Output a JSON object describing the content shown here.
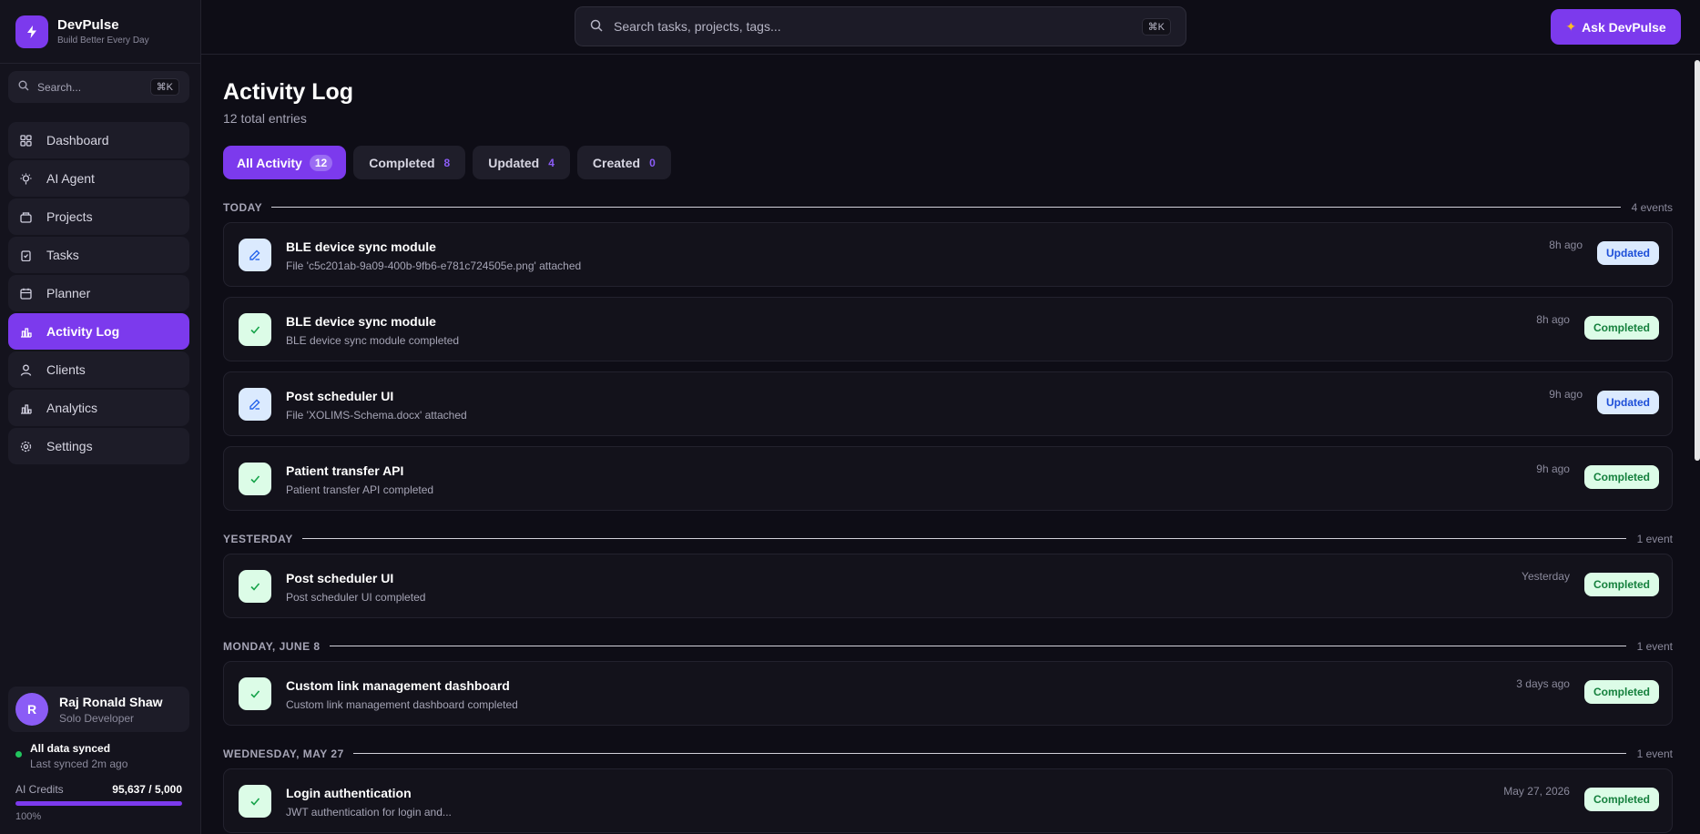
{
  "brand": {
    "name": "DevPulse",
    "tagline": "Build Better Every Day"
  },
  "sidebar": {
    "search_placeholder": "Search...",
    "search_shortcut": "⌘K",
    "items": [
      {
        "label": "Dashboard",
        "icon": "grid-icon"
      },
      {
        "label": "AI Agent",
        "icon": "bulb-icon"
      },
      {
        "label": "Projects",
        "icon": "folder-icon"
      },
      {
        "label": "Tasks",
        "icon": "clipboard-icon"
      },
      {
        "label": "Planner",
        "icon": "calendar-icon"
      },
      {
        "label": "Activity Log",
        "icon": "bar-chart-icon",
        "active": true
      },
      {
        "label": "Clients",
        "icon": "user-icon"
      },
      {
        "label": "Analytics",
        "icon": "bar-chart-icon"
      },
      {
        "label": "Settings",
        "icon": "gear-icon"
      }
    ]
  },
  "user": {
    "initial": "R",
    "name": "Raj Ronald Shaw",
    "role": "Solo Developer"
  },
  "sync": {
    "title": "All data synced",
    "subtitle": "Last synced 2m ago"
  },
  "credits": {
    "label": "AI Credits",
    "value": "95,637 / 5,000",
    "percent_text": "100%",
    "fill_fraction": 1.0
  },
  "topbar": {
    "search_placeholder": "Search tasks, projects, tags...",
    "search_shortcut": "⌘K",
    "ask_label": "Ask DevPulse"
  },
  "page": {
    "title": "Activity Log",
    "subtitle": "12 total entries"
  },
  "filters": [
    {
      "label": "All Activity",
      "count": "12",
      "active": true
    },
    {
      "label": "Completed",
      "count": "8"
    },
    {
      "label": "Updated",
      "count": "4"
    },
    {
      "label": "Created",
      "count": "0"
    }
  ],
  "groups": [
    {
      "label": "TODAY",
      "count": "4 events",
      "entries": [
        {
          "title": "BLE device sync module",
          "desc": "File 'c5c201ab-9a09-400b-9fb6-e781c724505e.png' attached",
          "time": "8h ago",
          "status": "Updated",
          "kind": "updated"
        },
        {
          "title": "BLE device sync module",
          "desc": "BLE device sync module completed",
          "time": "8h ago",
          "status": "Completed",
          "kind": "completed"
        },
        {
          "title": "Post scheduler UI",
          "desc": "File 'XOLIMS-Schema.docx' attached",
          "time": "9h ago",
          "status": "Updated",
          "kind": "updated"
        },
        {
          "title": "Patient transfer API",
          "desc": "Patient transfer API completed",
          "time": "9h ago",
          "status": "Completed",
          "kind": "completed"
        }
      ]
    },
    {
      "label": "YESTERDAY",
      "count": "1 event",
      "entries": [
        {
          "title": "Post scheduler UI",
          "desc": "Post scheduler UI completed",
          "time": "Yesterday",
          "status": "Completed",
          "kind": "completed"
        }
      ]
    },
    {
      "label": "MONDAY, JUNE 8",
      "count": "1 event",
      "entries": [
        {
          "title": "Custom link management dashboard",
          "desc": "Custom link management dashboard completed",
          "time": "3 days ago",
          "status": "Completed",
          "kind": "completed"
        }
      ]
    },
    {
      "label": "WEDNESDAY, MAY 27",
      "count": "1 event",
      "entries": [
        {
          "title": "Login authentication",
          "desc": "JWT authentication for login and...",
          "time": "May 27, 2026",
          "status": "Completed",
          "kind": "completed"
        }
      ]
    }
  ],
  "colors": {
    "accent": "#7c3aed",
    "background": "#0e0d16",
    "updated": "#1d4ed8",
    "completed": "#15803d"
  }
}
